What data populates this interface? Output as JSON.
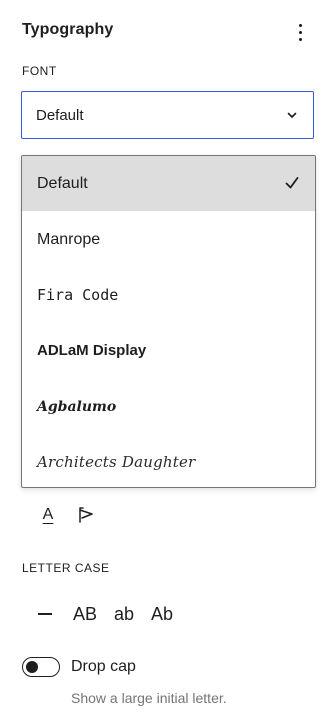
{
  "panel": {
    "title": "Typography",
    "menu_icon": "more-vertical-icon"
  },
  "font": {
    "label": "FONT",
    "selected_value": "Default",
    "chevron_icon": "chevron-down-icon",
    "options": [
      {
        "label": "Default",
        "selected": true
      },
      {
        "label": "Manrope",
        "selected": false
      },
      {
        "label": "Fira Code",
        "selected": false
      },
      {
        "label": "ADLaM Display",
        "selected": false
      },
      {
        "label": "Agbalumo",
        "selected": false
      },
      {
        "label": "Architects Daughter",
        "selected": false
      }
    ],
    "check_icon": "checkmark-icon"
  },
  "text_formatting": {
    "underline_glyph": "A",
    "underline_icon": "underline-icon",
    "writing_mode_icon": "writing-mode-icon"
  },
  "letter_case": {
    "label": "LETTER CASE",
    "options": [
      {
        "label": "",
        "icon": "minus-icon"
      },
      {
        "label": "AB"
      },
      {
        "label": "ab"
      },
      {
        "label": "Ab"
      }
    ]
  },
  "drop_cap": {
    "label": "Drop cap",
    "help": "Show a large initial letter.",
    "enabled": false
  },
  "colors": {
    "accent": "#3858e9",
    "selected_bg": "#dddddd",
    "text": "#1e1e1e",
    "muted": "#757575"
  }
}
